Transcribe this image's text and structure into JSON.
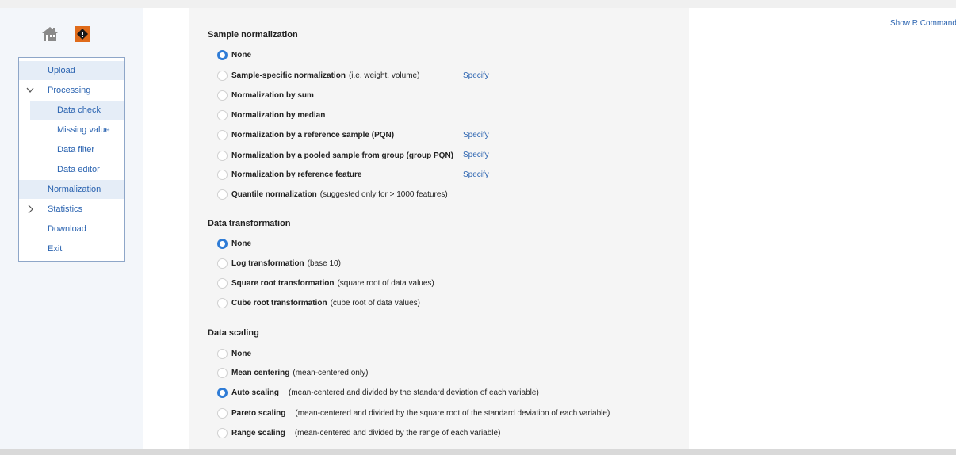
{
  "nav": {
    "items": [
      {
        "label": "Upload"
      },
      {
        "label": "Processing"
      },
      {
        "label": "Data check"
      },
      {
        "label": "Missing value"
      },
      {
        "label": "Data filter"
      },
      {
        "label": "Data editor"
      },
      {
        "label": "Normalization"
      },
      {
        "label": "Statistics"
      },
      {
        "label": "Download"
      },
      {
        "label": "Exit"
      }
    ]
  },
  "header": {
    "show_r_command": "Show R Command"
  },
  "icons": {
    "home": "home-icon",
    "help": "help-icon",
    "expand": "chevron-down-icon",
    "collapse": "chevron-right-icon"
  },
  "colors": {
    "accent": "#2f7cd6",
    "link": "#2a63b0",
    "nav_border": "#8ea6c8"
  },
  "sample_normalization": {
    "title": "Sample normalization",
    "specify_label": "Specify",
    "options": [
      {
        "name": "None",
        "desc": "",
        "selected": true
      },
      {
        "name": "Sample-specific normalization",
        "desc": "(i.e. weight, volume)",
        "selected": false
      },
      {
        "name": "Normalization by sum",
        "desc": "",
        "selected": false
      },
      {
        "name": "Normalization by median",
        "desc": "",
        "selected": false
      },
      {
        "name": "Normalization by a reference sample (PQN)",
        "desc": "",
        "selected": false
      },
      {
        "name": "Normalization by a pooled sample from group (group PQN)",
        "desc": "",
        "selected": false
      },
      {
        "name": "Normalization by reference feature",
        "desc": "",
        "selected": false
      },
      {
        "name": "Quantile normalization",
        "desc": "(suggested only for > 1000 features)",
        "selected": false
      }
    ]
  },
  "data_transformation": {
    "title": "Data transformation",
    "options": [
      {
        "name": "None",
        "desc": "",
        "selected": true
      },
      {
        "name": "Log transformation",
        "desc": "(base 10)",
        "selected": false
      },
      {
        "name": "Square root transformation",
        "desc": "(square root of data values)",
        "selected": false
      },
      {
        "name": "Cube root transformation",
        "desc": "(cube root of data values)",
        "selected": false
      }
    ]
  },
  "data_scaling": {
    "title": "Data scaling",
    "options": [
      {
        "name": "None",
        "desc": "",
        "selected": false
      },
      {
        "name": "Mean centering",
        "desc": "(mean-centered only)",
        "selected": false
      },
      {
        "name": "Auto scaling",
        "desc": "(mean-centered and divided by the standard deviation of each variable)",
        "selected": true
      },
      {
        "name": "Pareto scaling",
        "desc": "(mean-centered and divided by the square root of the standard deviation of each variable)",
        "selected": false
      },
      {
        "name": "Range scaling",
        "desc": "(mean-centered and divided by the range of each variable)",
        "selected": false
      }
    ]
  }
}
